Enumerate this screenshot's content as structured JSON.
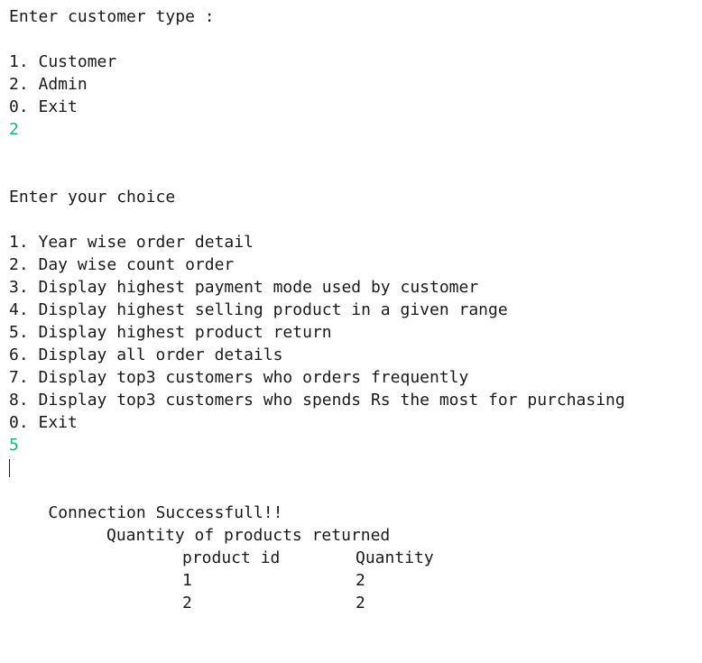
{
  "customer_prompt": "Enter customer type :",
  "customer_options": [
    "1. Customer",
    "2. Admin",
    "0. Exit"
  ],
  "customer_input": "2",
  "choice_prompt": "Enter your choice",
  "choice_options": [
    "1. Year wise order detail",
    "2. Day wise count order",
    "3. Display highest payment mode used by customer",
    "4. Display highest selling product in a given range",
    "5. Display highest product return",
    "6. Display all order details",
    "7. Display top3 customers who orders frequently",
    "8. Display top3 customers who spends Rs the most for purchasing",
    "0. Exit"
  ],
  "choice_input": "5",
  "connection_status": "Connection Successfull!!",
  "result_table": {
    "title": "Quantity of products returned",
    "headers": [
      "product id",
      "Quantity"
    ],
    "rows": [
      [
        "1",
        "2"
      ],
      [
        "2",
        "2"
      ]
    ]
  },
  "colors": {
    "text": "#1a1a1a",
    "input": "#18b87c",
    "background": "#ffffff"
  }
}
